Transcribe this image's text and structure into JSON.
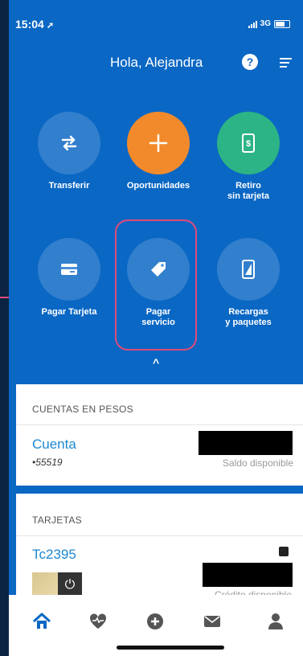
{
  "status": {
    "time": "15:04",
    "network": "3G"
  },
  "header": {
    "greeting": "Hola, Alejandra",
    "help": "?"
  },
  "actions": [
    {
      "label": "Transferir"
    },
    {
      "label": "Oportunidades"
    },
    {
      "label": "Retiro\nsin tarjeta"
    },
    {
      "label": "Pagar Tarjeta"
    },
    {
      "label": "Pagar\nservicio"
    },
    {
      "label": "Recargas\ny paquetes"
    }
  ],
  "accounts": {
    "section_title": "CUENTAS EN PESOS",
    "name": "Cuenta",
    "number": "•55519",
    "balance_label": "Saldo disponible"
  },
  "cards": {
    "section_title": "TARJETAS",
    "name": "Tc2395",
    "credit_label": "Crédito disponible"
  },
  "colors": {
    "primary": "#0a67c4",
    "orange": "#f28a2c",
    "teal": "#2cb386",
    "highlight": "#e04a7a",
    "link": "#1e88d0"
  },
  "bottom_nav": [
    "home-icon",
    "heart-pulse-icon",
    "plus-circle-icon",
    "mail-icon",
    "person-icon"
  ]
}
